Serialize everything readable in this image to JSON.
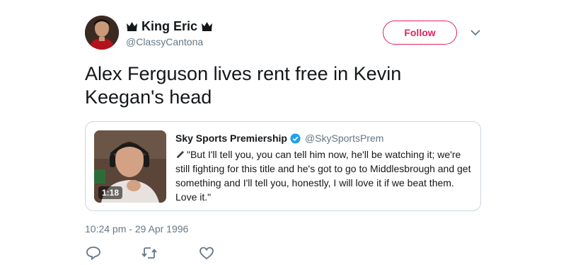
{
  "author": {
    "display_name": "King Eric",
    "handle": "@ClassyCantona",
    "crown_icon": "crown-icon",
    "avatar_icon": "avatar"
  },
  "follow": {
    "label": "Follow",
    "color": "#e0245e"
  },
  "tweet": {
    "text": "Alex Ferguson lives rent free in Kevin Keegan's head"
  },
  "quote": {
    "name": "Sky Sports Premiership",
    "handle": "@SkySportsPrem",
    "verified": true,
    "duration": "1:18",
    "text": "\"But I'll tell you, you can tell him now, he'll be watching it; we're still fighting for this title and he's got to go to Middlesbrough and get something and I'll tell you, honestly, I will love it if we beat them. Love it.\""
  },
  "timestamp": "10:24 pm - 29 Apr 1996",
  "actions": [
    "reply-icon",
    "retweet-icon",
    "like-icon"
  ],
  "colors": {
    "accent": "#e0245e",
    "secondary_text": "#657786",
    "verified": "#1da1f2",
    "border": "#ccd6dd"
  }
}
